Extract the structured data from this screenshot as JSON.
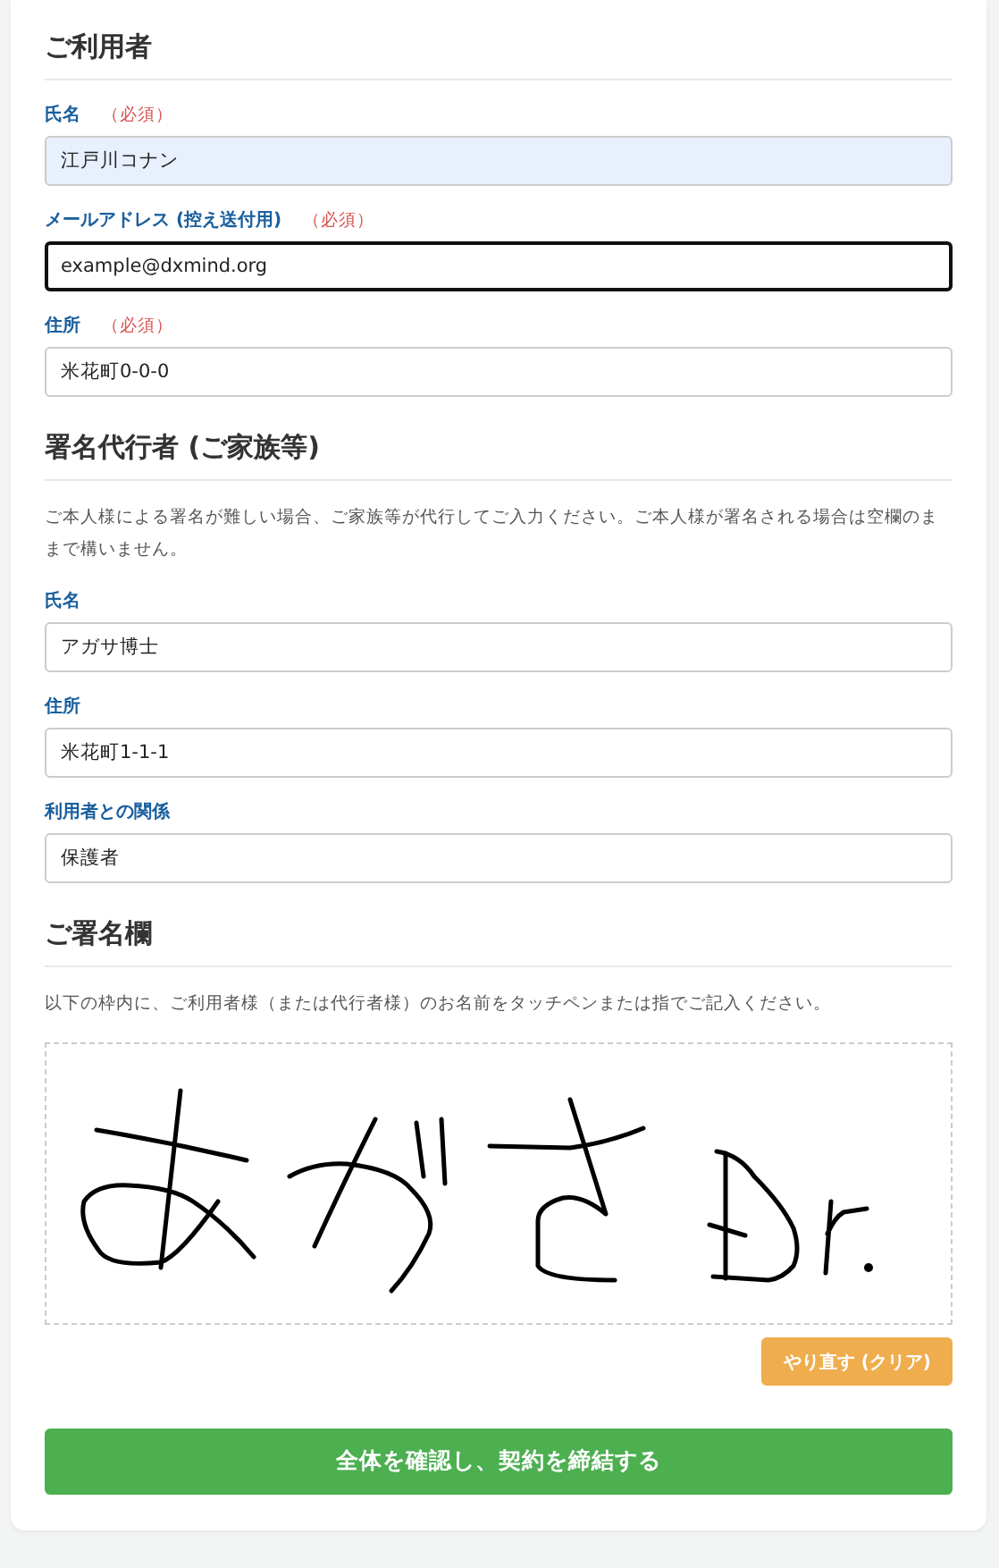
{
  "sections": [
    {
      "title": "ご利用者",
      "fields": [
        {
          "label": "氏名",
          "required_mark": "（必須）",
          "value": "江戸川コナン",
          "autofilled": true,
          "focused": false
        },
        {
          "label": "メールアドレス (控え送付用)",
          "required_mark": "（必須）",
          "value": "example@dxmind.org",
          "autofilled": false,
          "focused": true
        },
        {
          "label": "住所",
          "required_mark": "（必須）",
          "value": "米花町0-0-0",
          "autofilled": false,
          "focused": false
        }
      ]
    },
    {
      "title": "署名代行者 (ご家族等)",
      "description": "ご本人様による署名が難しい場合、ご家族等が代行してご入力ください。ご本人様が署名される場合は空欄のままで構いません。",
      "fields": [
        {
          "label": "氏名",
          "value": "アガサ博士",
          "autofilled": false,
          "focused": false
        },
        {
          "label": "住所",
          "value": "米花町1-1-1",
          "autofilled": false,
          "focused": false
        },
        {
          "label": "利用者との関係",
          "value": "保護者",
          "autofilled": false,
          "focused": false
        }
      ]
    },
    {
      "title": "ご署名欄",
      "description": "以下の枠内に、ご利用者様（または代行者様）のお名前をタッチペンまたは指でご記入ください。",
      "signature": {
        "signed": true
      }
    }
  ],
  "clear_button": "やり直す (クリア)",
  "submit_button": "全体を確認し、契約を締結する"
}
